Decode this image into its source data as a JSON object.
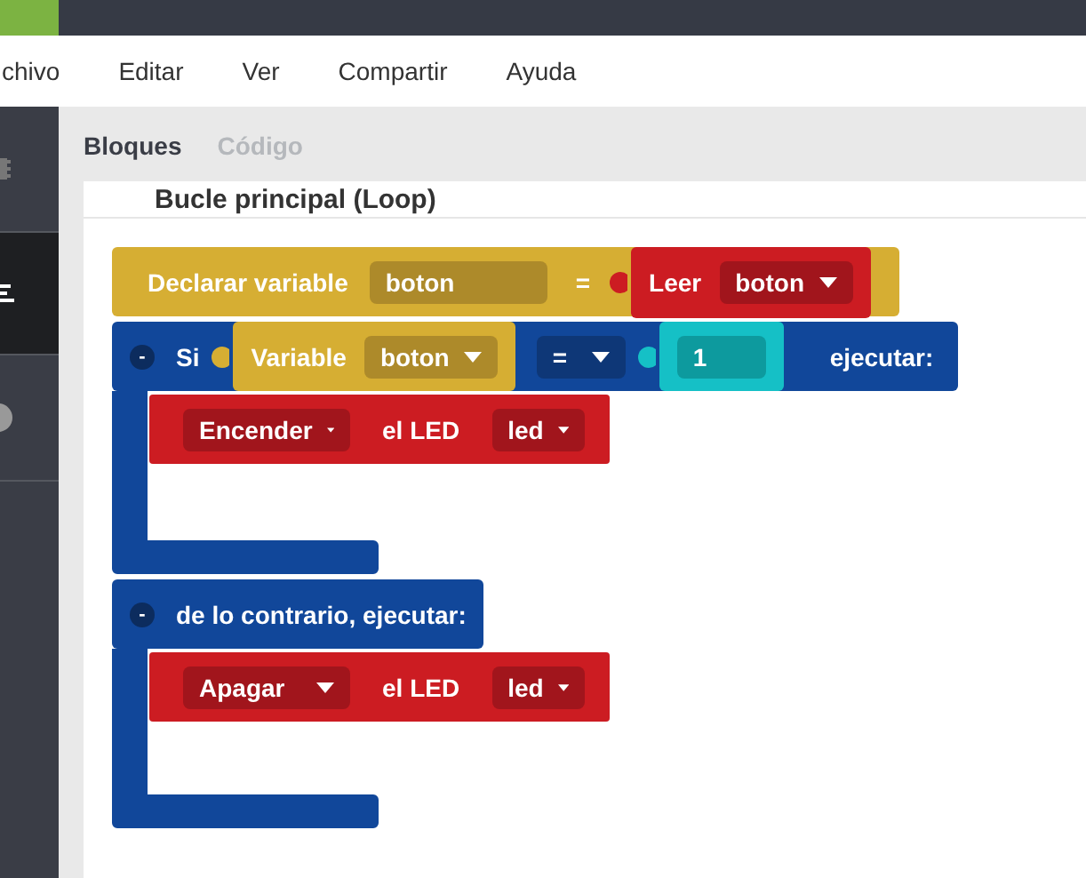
{
  "menu": [
    {
      "label": "chivo"
    },
    {
      "label": "Editar"
    },
    {
      "label": "Ver"
    },
    {
      "label": "Compartir"
    },
    {
      "label": "Ayuda"
    }
  ],
  "sidebar": [
    {
      "kind": "chip",
      "selected": false
    },
    {
      "kind": "lines",
      "selected": true
    },
    {
      "kind": "circle",
      "selected": false
    },
    {
      "kind": "empty",
      "selected": false
    }
  ],
  "tabs": [
    {
      "label": "Bloques",
      "selected": true
    },
    {
      "label": "Código",
      "selected": false
    }
  ],
  "workspace": {
    "title": "Bucle principal (Loop)",
    "blocks": [
      {
        "kind": "declare",
        "label": "Declarar variable",
        "name": "boton",
        "operator": "=",
        "value": {
          "label": "Leer",
          "dropdown": "boton"
        }
      },
      {
        "kind": "if",
        "collapse": "-",
        "label": "Si",
        "condition": {
          "label": "Variable",
          "dropdown": "boton"
        },
        "operator": "=",
        "value": "1",
        "suffix": "ejecutar:",
        "body": [
          {
            "action": "Encender",
            "label": "el LED",
            "target": "led"
          }
        ],
        "else": {
          "collapse": "-",
          "label": "de lo contrario, ejecutar:",
          "body": [
            {
              "action": "Apagar",
              "label": "el LED",
              "target": "led"
            }
          ]
        }
      }
    ]
  }
}
